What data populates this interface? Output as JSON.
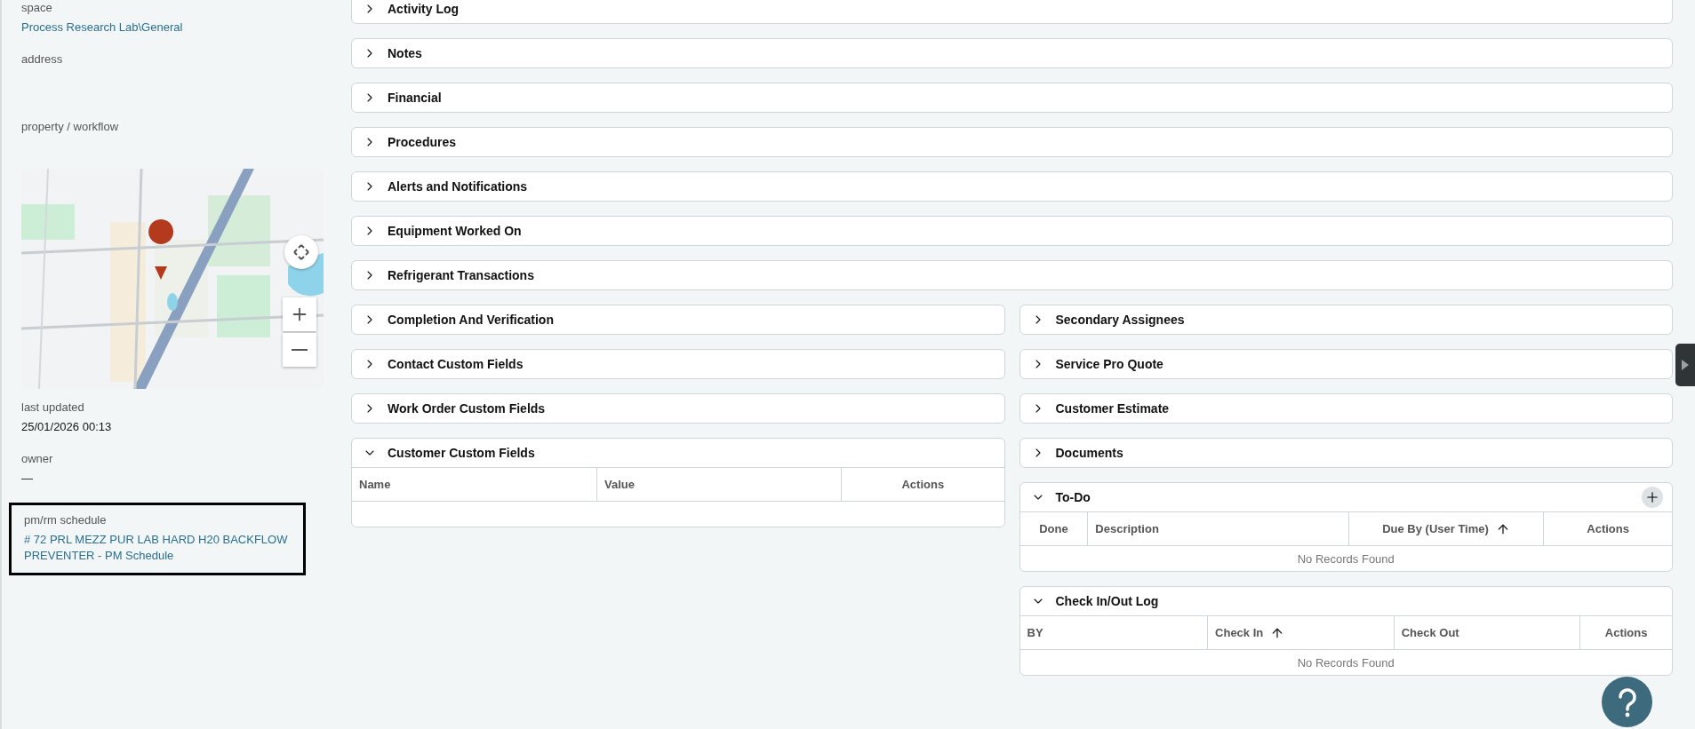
{
  "sidebar": {
    "fields": [
      {
        "label": "space",
        "value": "Process Research Lab\\General",
        "kind": "link"
      },
      {
        "label": "address",
        "kind": "blank"
      },
      {
        "label": "property / workflow",
        "kind": "blank"
      }
    ],
    "after_map": [
      {
        "label": "last updated",
        "value": "25/01/2026 00:13",
        "kind": "text"
      },
      {
        "label": "owner",
        "value": "—",
        "kind": "text"
      }
    ],
    "schedule": {
      "label": "pm/rm schedule",
      "value": "# 72 PRL MEZZ PUR LAB HARD H20 BACKFLOW PREVENTER - PM Schedule",
      "highlighted": true
    }
  },
  "full_panels": [
    {
      "title": "Activity Log",
      "expanded": false
    },
    {
      "title": "Notes",
      "expanded": false
    },
    {
      "title": "Financial",
      "expanded": false
    },
    {
      "title": "Procedures",
      "expanded": false
    },
    {
      "title": "Alerts and Notifications",
      "expanded": false
    },
    {
      "title": "Equipment Worked On",
      "expanded": false
    },
    {
      "title": "Refrigerant Transactions",
      "expanded": false
    }
  ],
  "left_column": [
    {
      "title": "Completion And Verification",
      "expanded": false
    },
    {
      "title": "Contact Custom Fields",
      "expanded": false
    },
    {
      "title": "Work Order Custom Fields",
      "expanded": false
    },
    {
      "title": "Customer Custom Fields",
      "expanded": true,
      "table": {
        "kind": "fields",
        "columns": [
          {
            "label": "Name",
            "sorted": false
          },
          {
            "label": "Value",
            "sorted": false
          },
          {
            "label": "Actions",
            "sorted": false
          }
        ]
      }
    }
  ],
  "right_column": [
    {
      "title": "Secondary Assignees",
      "expanded": false
    },
    {
      "title": "Service Pro Quote",
      "expanded": false
    },
    {
      "title": "Customer Estimate",
      "expanded": false
    },
    {
      "title": "Documents",
      "expanded": false
    },
    {
      "title": "To-Do",
      "expanded": true,
      "add_button": true,
      "table": {
        "kind": "todo",
        "columns": [
          {
            "label": "Done",
            "sorted": false
          },
          {
            "label": "Description",
            "sorted": false
          },
          {
            "label": "Due By (User Time)",
            "sorted": true
          },
          {
            "label": "Actions",
            "sorted": false
          }
        ],
        "empty_text": "No Records Found"
      }
    },
    {
      "title": "Check In/Out Log",
      "expanded": true,
      "table": {
        "kind": "checklog",
        "columns": [
          {
            "label": "BY",
            "sorted": false
          },
          {
            "label": "Check In",
            "sorted": true
          },
          {
            "label": "Check Out",
            "sorted": false
          },
          {
            "label": "Actions",
            "sorted": false
          }
        ],
        "empty_text": "No Records Found"
      }
    }
  ]
}
